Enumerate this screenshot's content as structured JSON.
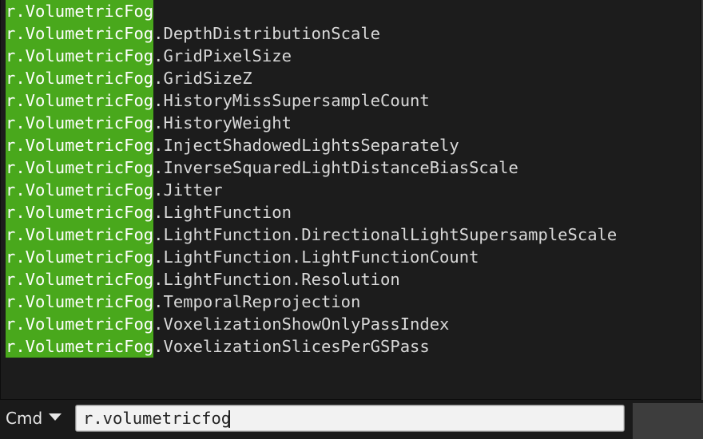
{
  "console": {
    "match_prefix": "r.VolumetricFog",
    "suggestions": [
      {
        "match": "r.VolumetricFog",
        "rest": ""
      },
      {
        "match": "r.VolumetricFog",
        "rest": ".DepthDistributionScale"
      },
      {
        "match": "r.VolumetricFog",
        "rest": ".GridPixelSize"
      },
      {
        "match": "r.VolumetricFog",
        "rest": ".GridSizeZ"
      },
      {
        "match": "r.VolumetricFog",
        "rest": ".HistoryMissSupersampleCount"
      },
      {
        "match": "r.VolumetricFog",
        "rest": ".HistoryWeight"
      },
      {
        "match": "r.VolumetricFog",
        "rest": ".InjectShadowedLightsSeparately"
      },
      {
        "match": "r.VolumetricFog",
        "rest": ".InverseSquaredLightDistanceBiasScale"
      },
      {
        "match": "r.VolumetricFog",
        "rest": ".Jitter"
      },
      {
        "match": "r.VolumetricFog",
        "rest": ".LightFunction"
      },
      {
        "match": "r.VolumetricFog",
        "rest": ".LightFunction.DirectionalLightSupersampleScale"
      },
      {
        "match": "r.VolumetricFog",
        "rest": ".LightFunction.LightFunctionCount"
      },
      {
        "match": "r.VolumetricFog",
        "rest": ".LightFunction.Resolution"
      },
      {
        "match": "r.VolumetricFog",
        "rest": ".TemporalReprojection"
      },
      {
        "match": "r.VolumetricFog",
        "rest": ".VoxelizationShowOnlyPassIndex"
      },
      {
        "match": "r.VolumetricFog",
        "rest": ".VoxelizationSlicesPerGSPass"
      }
    ]
  },
  "command_bar": {
    "mode_label": "Cmd",
    "mode_icon": "chevron-down-icon",
    "input_value": "r.volumetricfog"
  },
  "colors": {
    "match_highlight": "#49a81c",
    "panel_background": "#1c1c1c",
    "text": "#d9d9d9"
  }
}
